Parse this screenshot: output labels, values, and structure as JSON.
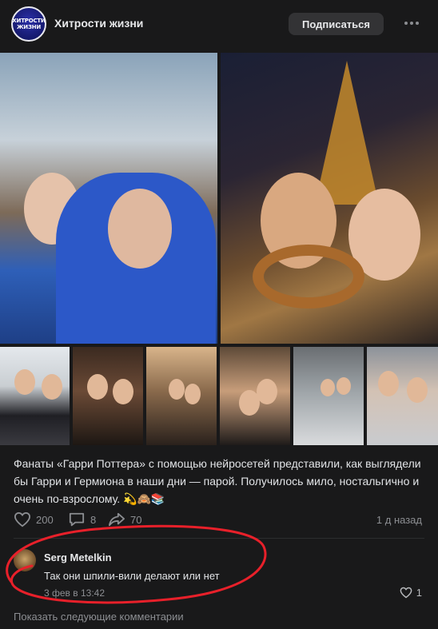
{
  "header": {
    "avatar_text": [
      "ХИТРОСТИ",
      "ЖИЗНИ"
    ],
    "title": "Хитрости жизни",
    "subscribe_label": "Подписаться"
  },
  "post": {
    "caption": "Фанаты «Гарри Поттера» с помощью нейросетей представили, как выглядели бы Гарри и Гермиона в наши дни — парой. Получилось мило, ностальгично и очень по-взрослому. 💫🙈📚",
    "likes": "200",
    "comments": "8",
    "shares": "70",
    "time": "1 д назад"
  },
  "comment": {
    "author": "Serg Metelkin",
    "text": "Так они шпили-вили делают или нет",
    "date": "3 фев в 13:42",
    "likes": "1"
  },
  "show_more_label": "Показать следующие комментарии",
  "colors": {
    "background": "#19191a",
    "annotation": "#e8202a",
    "muted": "#8c8e92"
  }
}
